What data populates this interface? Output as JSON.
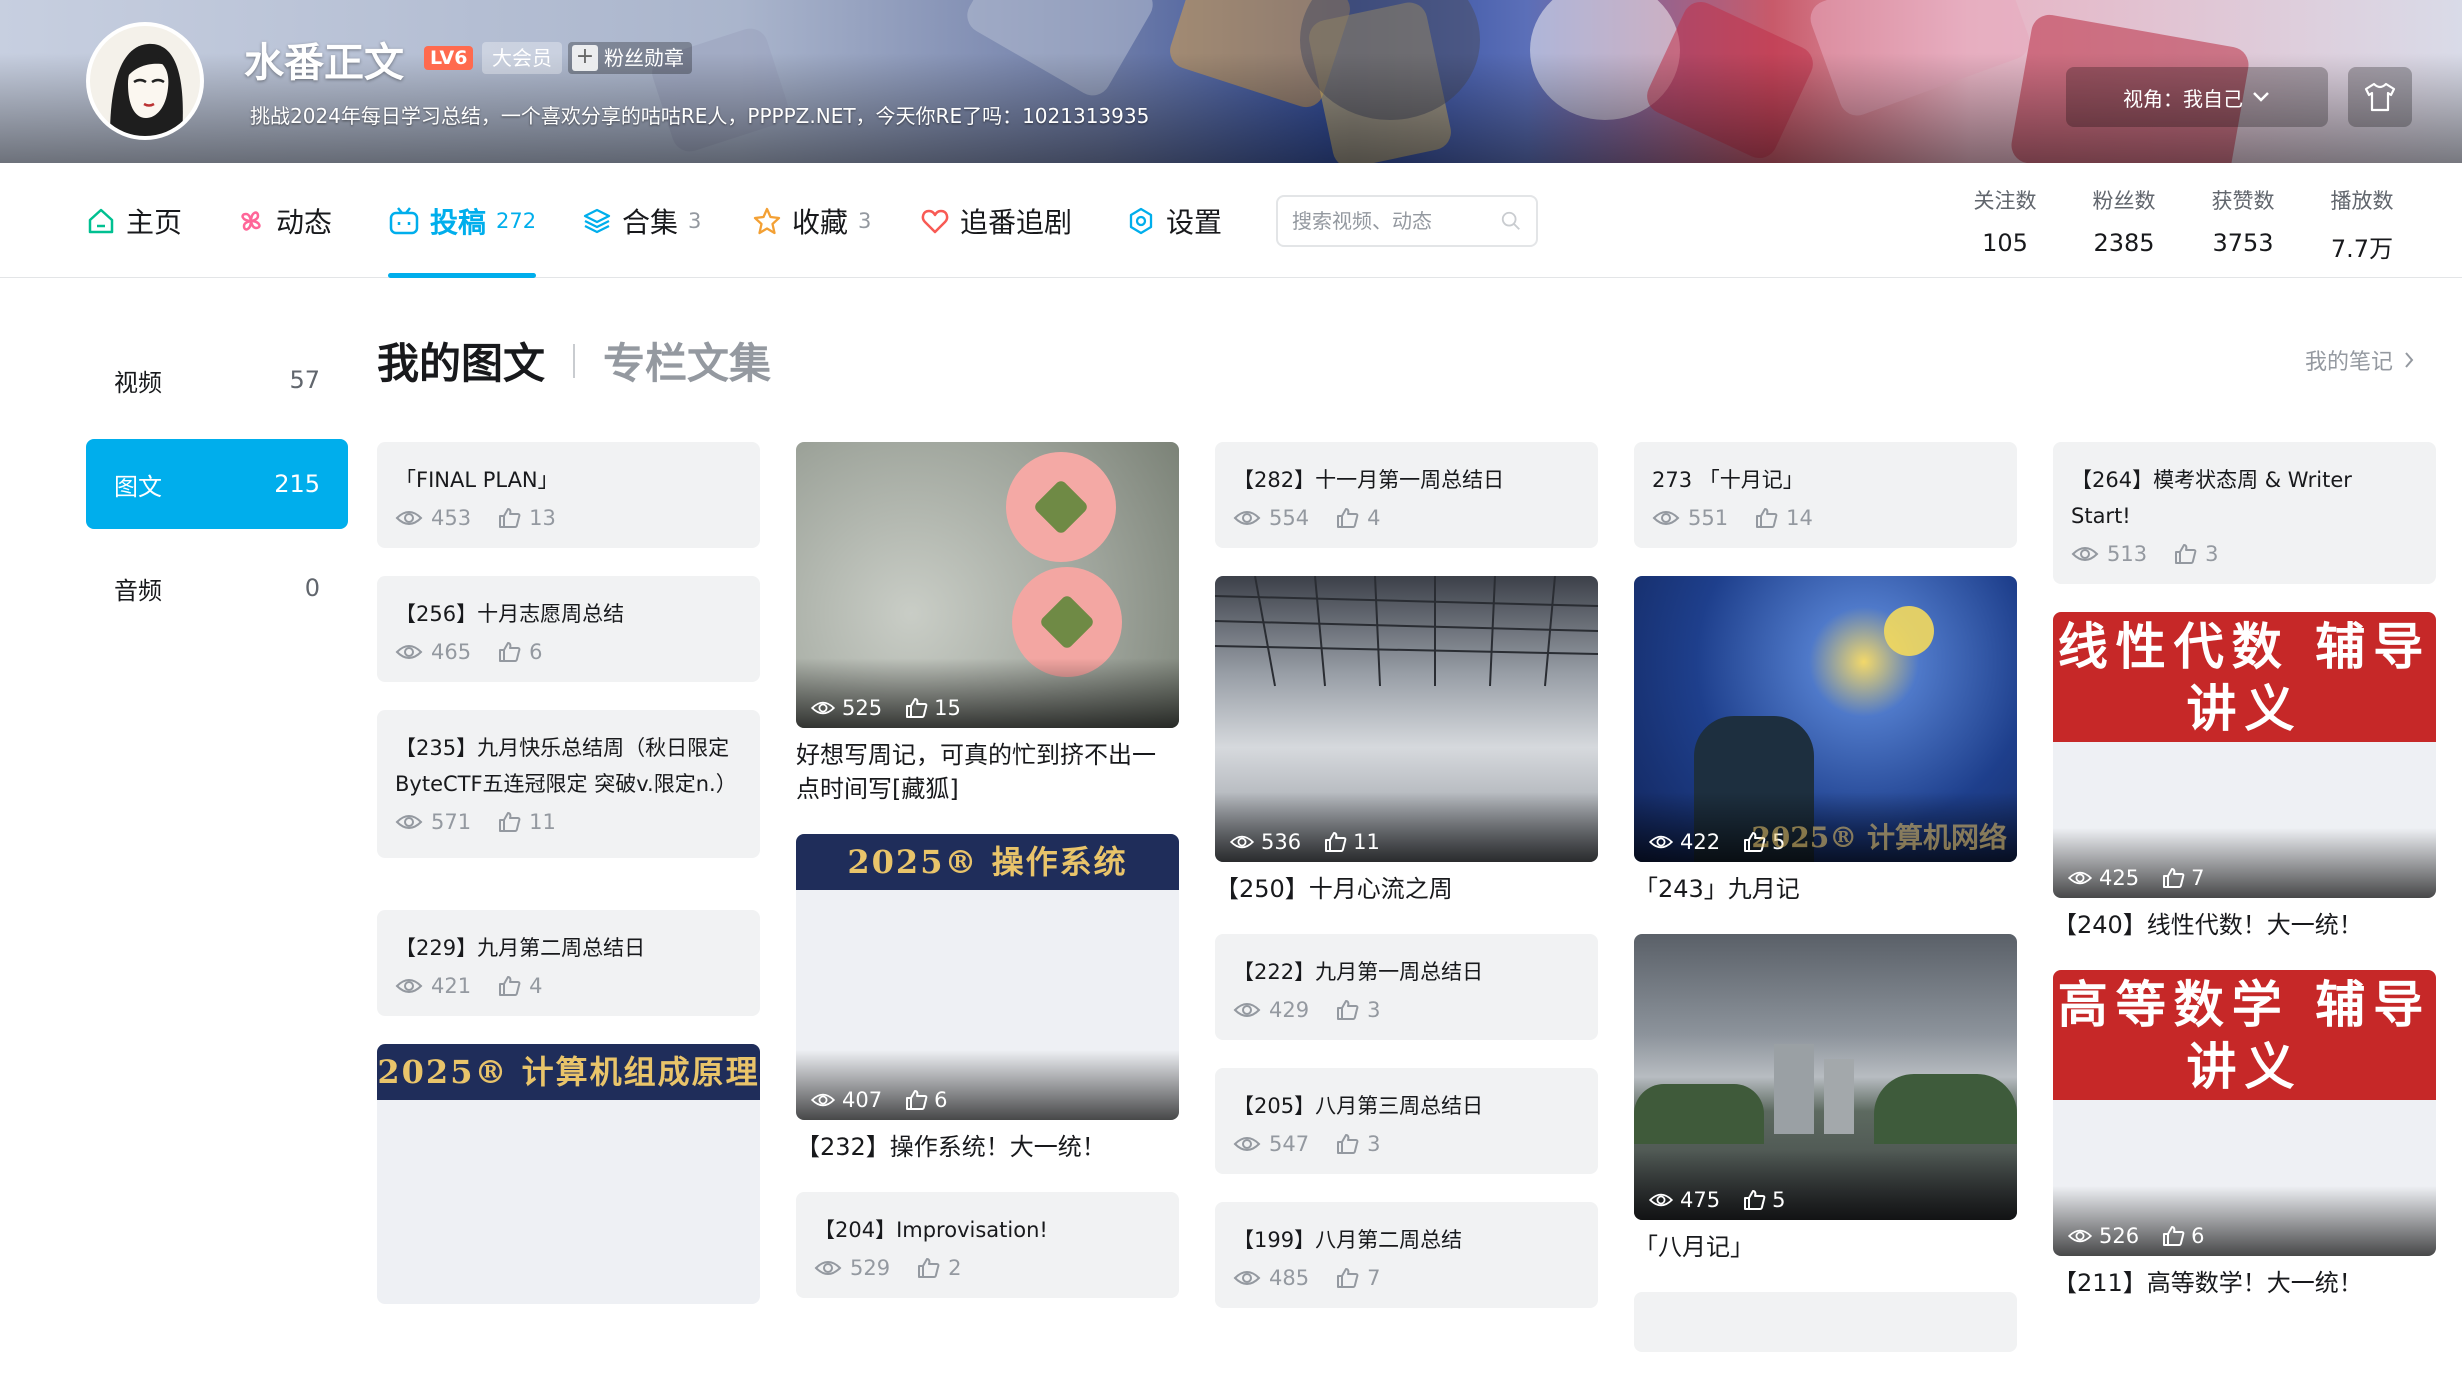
{
  "header": {
    "username": "水番正文",
    "level": "LV6",
    "vip_label": "大会员",
    "fans_badge_label": "粉丝勋章",
    "signature": "挑战2024年每日学习总结，一个喜欢分享的咕咕RE人，PPPPZ.NET，今天你RE了吗：1021313935",
    "view_label": "视角：我自己"
  },
  "nav": {
    "items": [
      {
        "label": "主页",
        "count": "",
        "icon": "home-icon"
      },
      {
        "label": "动态",
        "count": "",
        "icon": "pinwheel-icon"
      },
      {
        "label": "投稿",
        "count": "272",
        "icon": "tv-icon"
      },
      {
        "label": "合集",
        "count": "3",
        "icon": "layers-icon"
      },
      {
        "label": "收藏",
        "count": "3",
        "icon": "star-icon"
      },
      {
        "label": "追番追剧",
        "count": "",
        "icon": "heart-icon"
      },
      {
        "label": "设置",
        "count": "",
        "icon": "settings-icon"
      }
    ],
    "active_item": "投稿",
    "search_placeholder": "搜索视频、动态",
    "stats": [
      {
        "label": "关注数",
        "value": "105"
      },
      {
        "label": "粉丝数",
        "value": "2385"
      },
      {
        "label": "获赞数",
        "value": "3753"
      },
      {
        "label": "播放数",
        "value": "7.7万"
      }
    ]
  },
  "sidebar": {
    "items": [
      {
        "label": "视频",
        "count": "57"
      },
      {
        "label": "图文",
        "count": "215"
      },
      {
        "label": "音频",
        "count": "0"
      }
    ],
    "active_item": "图文"
  },
  "content": {
    "tab_active": "我的图文",
    "tab_other": "专栏文集",
    "notes_link": "我的笔记",
    "columns": [
      [
        {
          "title": "「FINAL PLAN」",
          "views": "453",
          "likes": "13"
        },
        {
          "title": "【256】十月志愿周总结",
          "views": "465",
          "likes": "6"
        },
        {
          "title": "【235】九月快乐总结周（秋日限定ByteCTF五连冠限定 突破v.限定n.）",
          "views": "571",
          "likes": "11"
        },
        {
          "title": "【229】九月第二周总结日",
          "views": "421",
          "likes": "4"
        },
        {
          "title": "",
          "views": "",
          "likes": "",
          "banner": "2025® 计算机组成原理"
        }
      ],
      [
        {
          "title": "好想写周记，可真的忙到挤不出一点时间写[藏狐]",
          "views": "525",
          "likes": "15"
        },
        {
          "title": "【232】操作系统！大一统！",
          "views": "407",
          "likes": "6",
          "banner": "2025® 操作系统"
        },
        {
          "title": "【204】Improvisation!",
          "views": "529",
          "likes": "2"
        }
      ],
      [
        {
          "title": "【282】十一月第一周总结日",
          "views": "554",
          "likes": "4"
        },
        {
          "title": "【250】十月心流之周",
          "views": "536",
          "likes": "11"
        },
        {
          "title": "【222】九月第一周总结日",
          "views": "429",
          "likes": "3"
        },
        {
          "title": "【205】八月第三周总结日",
          "views": "547",
          "likes": "3"
        },
        {
          "title": "【199】八月第二周总结",
          "views": "485",
          "likes": "7"
        }
      ],
      [
        {
          "title": "273 「十月记」",
          "views": "551",
          "likes": "14"
        },
        {
          "title": "「243」九月记",
          "views": "422",
          "likes": "5",
          "banner": "2025® 计算机网络"
        },
        {
          "title": "「八月记」",
          "views": "475",
          "likes": "5"
        }
      ],
      [
        {
          "title": "【264】模考状态周 & Writer Start!",
          "views": "513",
          "likes": "3"
        },
        {
          "title": "【240】线性代数！大一统！",
          "views": "425",
          "likes": "7",
          "banner": "线性代数 辅导讲义"
        },
        {
          "title": "【211】高等数学！大一统！",
          "views": "526",
          "likes": "6",
          "banner": "高等数学 辅导讲义"
        }
      ]
    ]
  },
  "colors": {
    "accent": "#00aeec",
    "text": "#18191c",
    "muted": "#9499a0",
    "card_bg": "#f1f2f3",
    "level": "#ff6a4e"
  }
}
